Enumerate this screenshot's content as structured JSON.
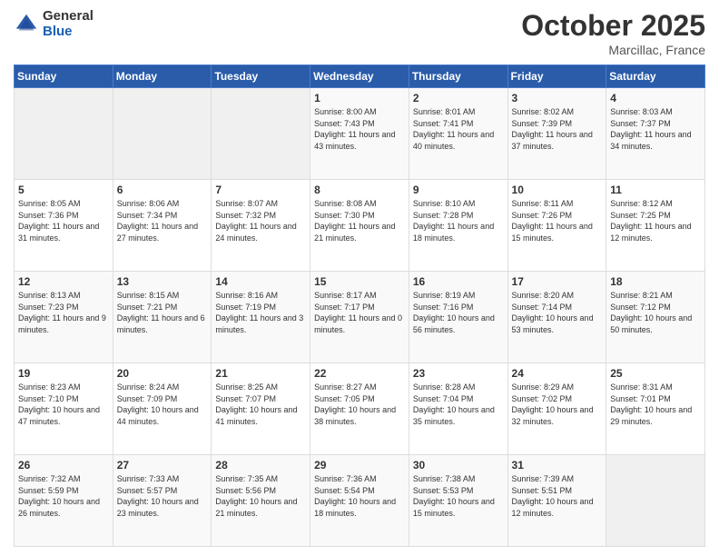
{
  "header": {
    "logo_general": "General",
    "logo_blue": "Blue",
    "month": "October 2025",
    "location": "Marcillac, France"
  },
  "days_of_week": [
    "Sunday",
    "Monday",
    "Tuesday",
    "Wednesday",
    "Thursday",
    "Friday",
    "Saturday"
  ],
  "weeks": [
    [
      {
        "day": "",
        "info": ""
      },
      {
        "day": "",
        "info": ""
      },
      {
        "day": "",
        "info": ""
      },
      {
        "day": "1",
        "info": "Sunrise: 8:00 AM\nSunset: 7:43 PM\nDaylight: 11 hours\nand 43 minutes."
      },
      {
        "day": "2",
        "info": "Sunrise: 8:01 AM\nSunset: 7:41 PM\nDaylight: 11 hours\nand 40 minutes."
      },
      {
        "day": "3",
        "info": "Sunrise: 8:02 AM\nSunset: 7:39 PM\nDaylight: 11 hours\nand 37 minutes."
      },
      {
        "day": "4",
        "info": "Sunrise: 8:03 AM\nSunset: 7:37 PM\nDaylight: 11 hours\nand 34 minutes."
      }
    ],
    [
      {
        "day": "5",
        "info": "Sunrise: 8:05 AM\nSunset: 7:36 PM\nDaylight: 11 hours\nand 31 minutes."
      },
      {
        "day": "6",
        "info": "Sunrise: 8:06 AM\nSunset: 7:34 PM\nDaylight: 11 hours\nand 27 minutes."
      },
      {
        "day": "7",
        "info": "Sunrise: 8:07 AM\nSunset: 7:32 PM\nDaylight: 11 hours\nand 24 minutes."
      },
      {
        "day": "8",
        "info": "Sunrise: 8:08 AM\nSunset: 7:30 PM\nDaylight: 11 hours\nand 21 minutes."
      },
      {
        "day": "9",
        "info": "Sunrise: 8:10 AM\nSunset: 7:28 PM\nDaylight: 11 hours\nand 18 minutes."
      },
      {
        "day": "10",
        "info": "Sunrise: 8:11 AM\nSunset: 7:26 PM\nDaylight: 11 hours\nand 15 minutes."
      },
      {
        "day": "11",
        "info": "Sunrise: 8:12 AM\nSunset: 7:25 PM\nDaylight: 11 hours\nand 12 minutes."
      }
    ],
    [
      {
        "day": "12",
        "info": "Sunrise: 8:13 AM\nSunset: 7:23 PM\nDaylight: 11 hours\nand 9 minutes."
      },
      {
        "day": "13",
        "info": "Sunrise: 8:15 AM\nSunset: 7:21 PM\nDaylight: 11 hours\nand 6 minutes."
      },
      {
        "day": "14",
        "info": "Sunrise: 8:16 AM\nSunset: 7:19 PM\nDaylight: 11 hours\nand 3 minutes."
      },
      {
        "day": "15",
        "info": "Sunrise: 8:17 AM\nSunset: 7:17 PM\nDaylight: 11 hours\nand 0 minutes."
      },
      {
        "day": "16",
        "info": "Sunrise: 8:19 AM\nSunset: 7:16 PM\nDaylight: 10 hours\nand 56 minutes."
      },
      {
        "day": "17",
        "info": "Sunrise: 8:20 AM\nSunset: 7:14 PM\nDaylight: 10 hours\nand 53 minutes."
      },
      {
        "day": "18",
        "info": "Sunrise: 8:21 AM\nSunset: 7:12 PM\nDaylight: 10 hours\nand 50 minutes."
      }
    ],
    [
      {
        "day": "19",
        "info": "Sunrise: 8:23 AM\nSunset: 7:10 PM\nDaylight: 10 hours\nand 47 minutes."
      },
      {
        "day": "20",
        "info": "Sunrise: 8:24 AM\nSunset: 7:09 PM\nDaylight: 10 hours\nand 44 minutes."
      },
      {
        "day": "21",
        "info": "Sunrise: 8:25 AM\nSunset: 7:07 PM\nDaylight: 10 hours\nand 41 minutes."
      },
      {
        "day": "22",
        "info": "Sunrise: 8:27 AM\nSunset: 7:05 PM\nDaylight: 10 hours\nand 38 minutes."
      },
      {
        "day": "23",
        "info": "Sunrise: 8:28 AM\nSunset: 7:04 PM\nDaylight: 10 hours\nand 35 minutes."
      },
      {
        "day": "24",
        "info": "Sunrise: 8:29 AM\nSunset: 7:02 PM\nDaylight: 10 hours\nand 32 minutes."
      },
      {
        "day": "25",
        "info": "Sunrise: 8:31 AM\nSunset: 7:01 PM\nDaylight: 10 hours\nand 29 minutes."
      }
    ],
    [
      {
        "day": "26",
        "info": "Sunrise: 7:32 AM\nSunset: 5:59 PM\nDaylight: 10 hours\nand 26 minutes."
      },
      {
        "day": "27",
        "info": "Sunrise: 7:33 AM\nSunset: 5:57 PM\nDaylight: 10 hours\nand 23 minutes."
      },
      {
        "day": "28",
        "info": "Sunrise: 7:35 AM\nSunset: 5:56 PM\nDaylight: 10 hours\nand 21 minutes."
      },
      {
        "day": "29",
        "info": "Sunrise: 7:36 AM\nSunset: 5:54 PM\nDaylight: 10 hours\nand 18 minutes."
      },
      {
        "day": "30",
        "info": "Sunrise: 7:38 AM\nSunset: 5:53 PM\nDaylight: 10 hours\nand 15 minutes."
      },
      {
        "day": "31",
        "info": "Sunrise: 7:39 AM\nSunset: 5:51 PM\nDaylight: 10 hours\nand 12 minutes."
      },
      {
        "day": "",
        "info": ""
      }
    ]
  ]
}
